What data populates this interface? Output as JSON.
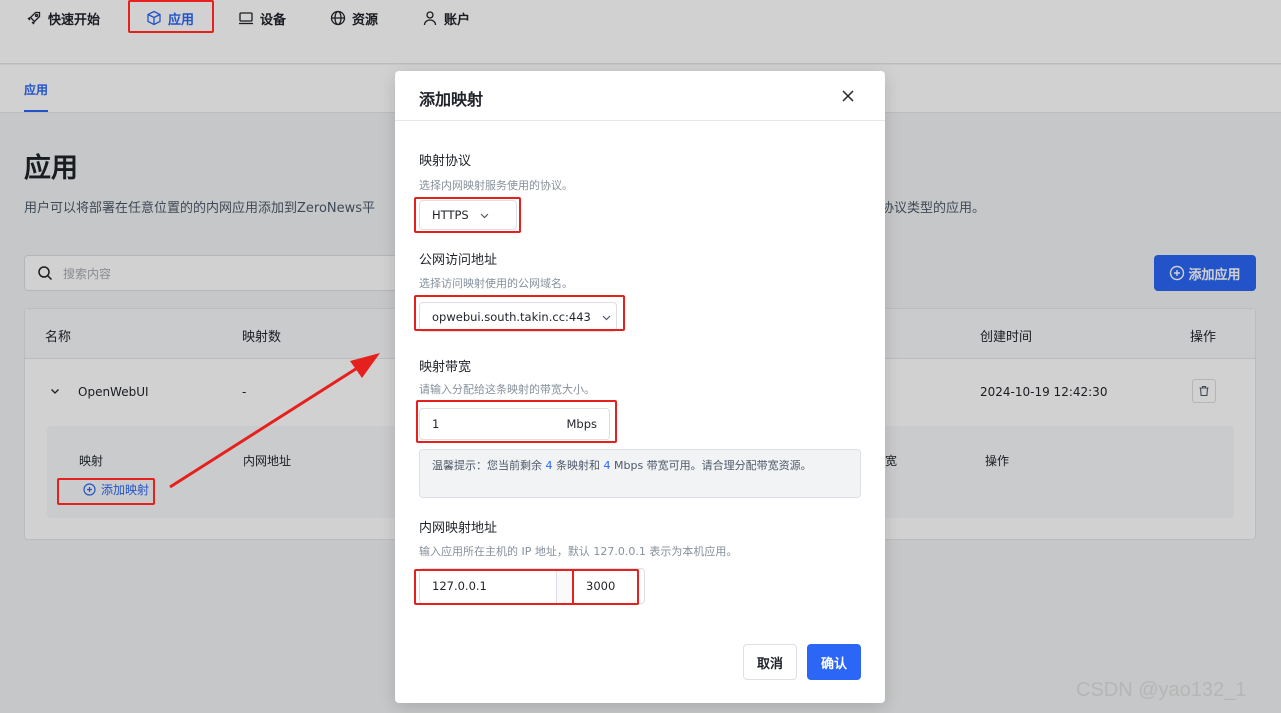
{
  "nav": {
    "items": [
      {
        "label": "快速开始",
        "icon": "rocket-icon"
      },
      {
        "label": "应用",
        "icon": "cube-icon"
      },
      {
        "label": "设备",
        "icon": "monitor-icon"
      },
      {
        "label": "资源",
        "icon": "globe-icon"
      },
      {
        "label": "账户",
        "icon": "user-icon"
      }
    ],
    "active": "应用"
  },
  "subnav": {
    "tab": "应用"
  },
  "page": {
    "title": "应用",
    "description_left": "用户可以将部署在任意位置的的内网应用添加到ZeroNews平",
    "description_right": "协议类型的应用。"
  },
  "toolbar": {
    "search_placeholder": "搜索内容",
    "add_app_label": "添加应用"
  },
  "table": {
    "headers": {
      "name": "名称",
      "mappings": "映射数",
      "created": "创建时间",
      "actions": "操作"
    },
    "rows": [
      {
        "name": "OpenWebUI",
        "mappings": "-",
        "created": "2024-10-19 12:42:30"
      }
    ],
    "sub_headers": {
      "mapping": "映射",
      "internal_address": "内网地址",
      "bandwidth": "宽",
      "actions": "操作"
    },
    "add_mapping_label": "添加映射"
  },
  "modal": {
    "title": "添加映射",
    "protocol": {
      "label": "映射协议",
      "hint": "选择内网映射服务使用的协议。",
      "value": "HTTPS"
    },
    "public_address": {
      "label": "公网访问地址",
      "hint": "选择访问映射使用的公网域名。",
      "value": "opwebui.south.takin.cc:443"
    },
    "bandwidth": {
      "label": "映射带宽",
      "hint": "请输入分配给这条映射的带宽大小。",
      "value": "1",
      "unit": "Mbps"
    },
    "tip": {
      "prefix": "温馨提示：您当前剩余",
      "count": "4",
      "middle": "条映射和",
      "bandwidth": "4",
      "suffix": "Mbps 带宽可用。请合理分配带宽资源。"
    },
    "internal_address": {
      "label": "内网映射地址",
      "hint": "输入应用所在主机的 IP 地址，默认 127.0.0.1 表示为本机应用。",
      "ip": "127.0.0.1",
      "port": "3000"
    },
    "cancel_label": "取消",
    "confirm_label": "确认"
  },
  "colors": {
    "accent": "#2b66f6",
    "annotation": "#e6201d"
  },
  "watermark": "CSDN @yao132_1"
}
